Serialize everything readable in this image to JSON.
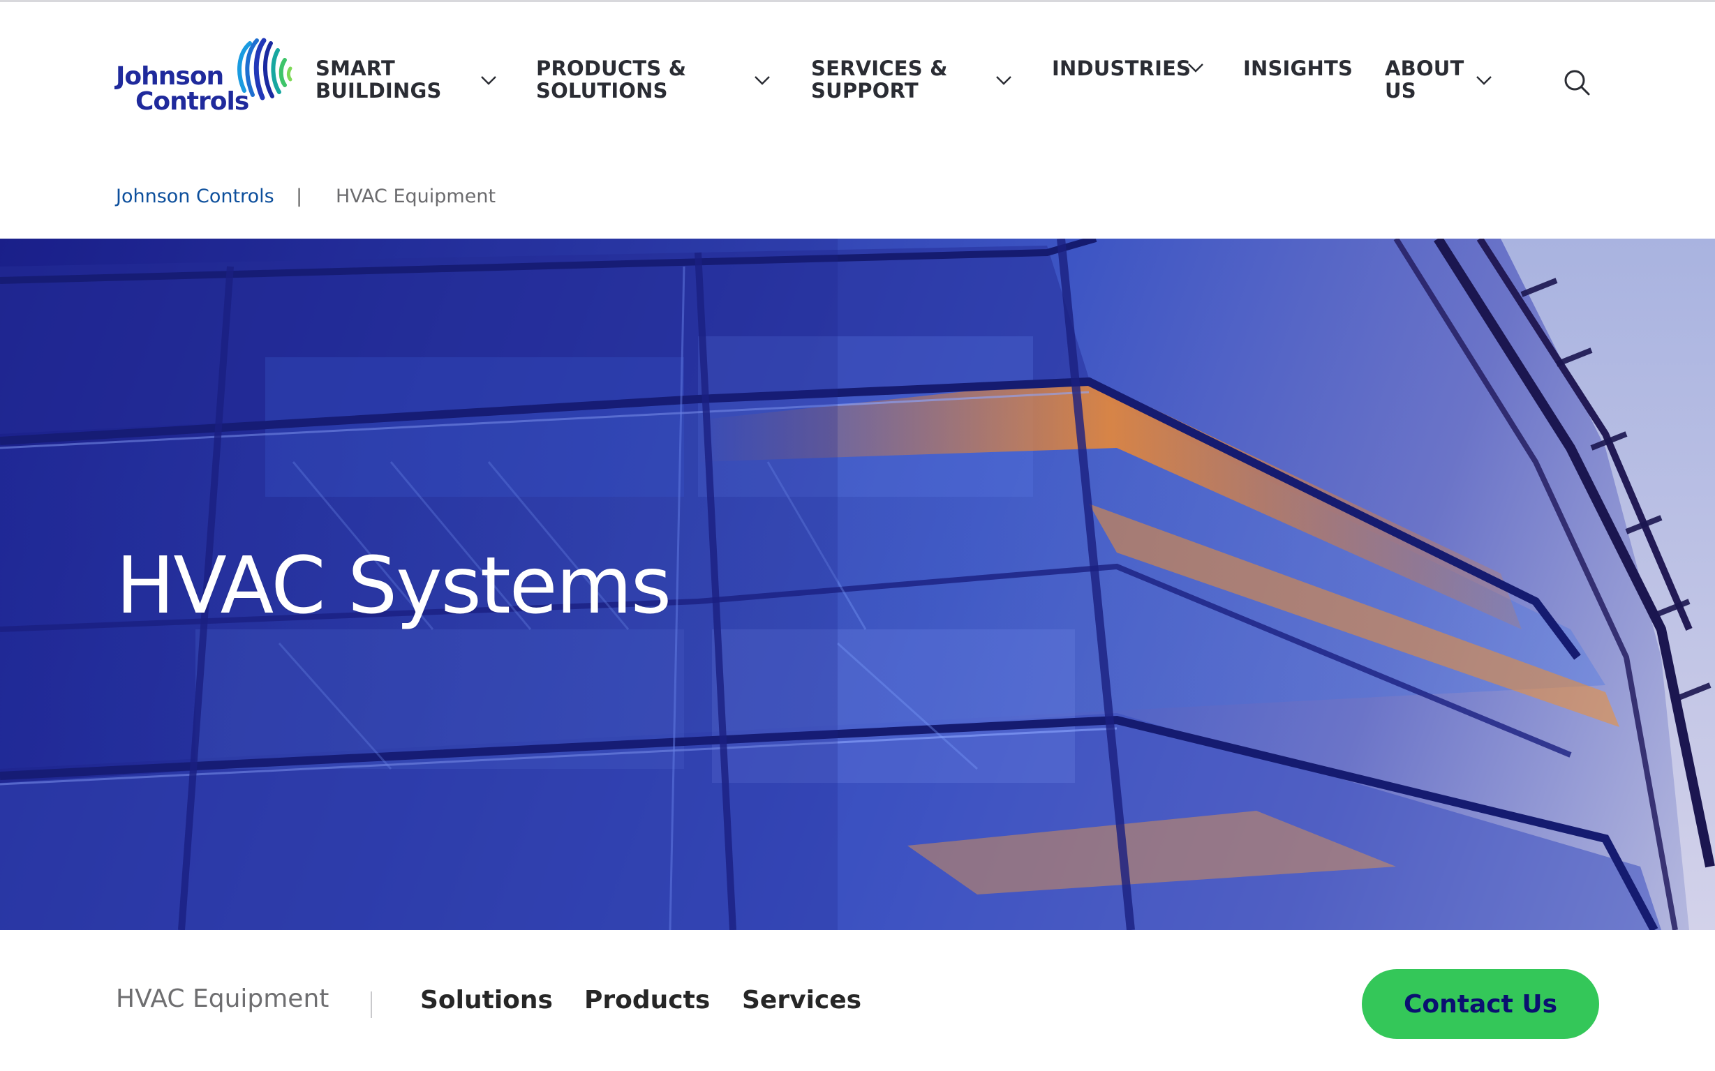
{
  "header": {
    "logo": {
      "line1": "Johnson",
      "line2": "Controls",
      "icon": "johnson-controls-globe-icon"
    },
    "nav": [
      {
        "label": "SMART",
        "label2": "BUILDINGS",
        "has_dropdown": true
      },
      {
        "label": "PRODUCTS &",
        "label2": "SOLUTIONS",
        "has_dropdown": true
      },
      {
        "label": "SERVICES &",
        "label2": "SUPPORT",
        "has_dropdown": true
      },
      {
        "label": "INDUSTRIES",
        "label2": "",
        "has_dropdown": true
      },
      {
        "label": "INSIGHTS",
        "label2": "",
        "has_dropdown": false
      },
      {
        "label": "ABOUT",
        "label2": "US",
        "has_dropdown": true
      }
    ],
    "search_icon": "search-icon"
  },
  "breadcrumb": {
    "home": "Johnson Controls",
    "separator": "|",
    "current": "HVAC Equipment"
  },
  "hero": {
    "title": "HVAC Systems"
  },
  "subnav": {
    "title": "HVAC Equipment",
    "links": [
      "Solutions",
      "Products",
      "Services"
    ],
    "cta": "Contact Us"
  },
  "colors": {
    "brand_blue": "#1f2a9c",
    "link_blue": "#0d4f9c",
    "cta_green": "#34c759",
    "cta_text": "#0a1070",
    "nav_text": "#2a2c33"
  }
}
